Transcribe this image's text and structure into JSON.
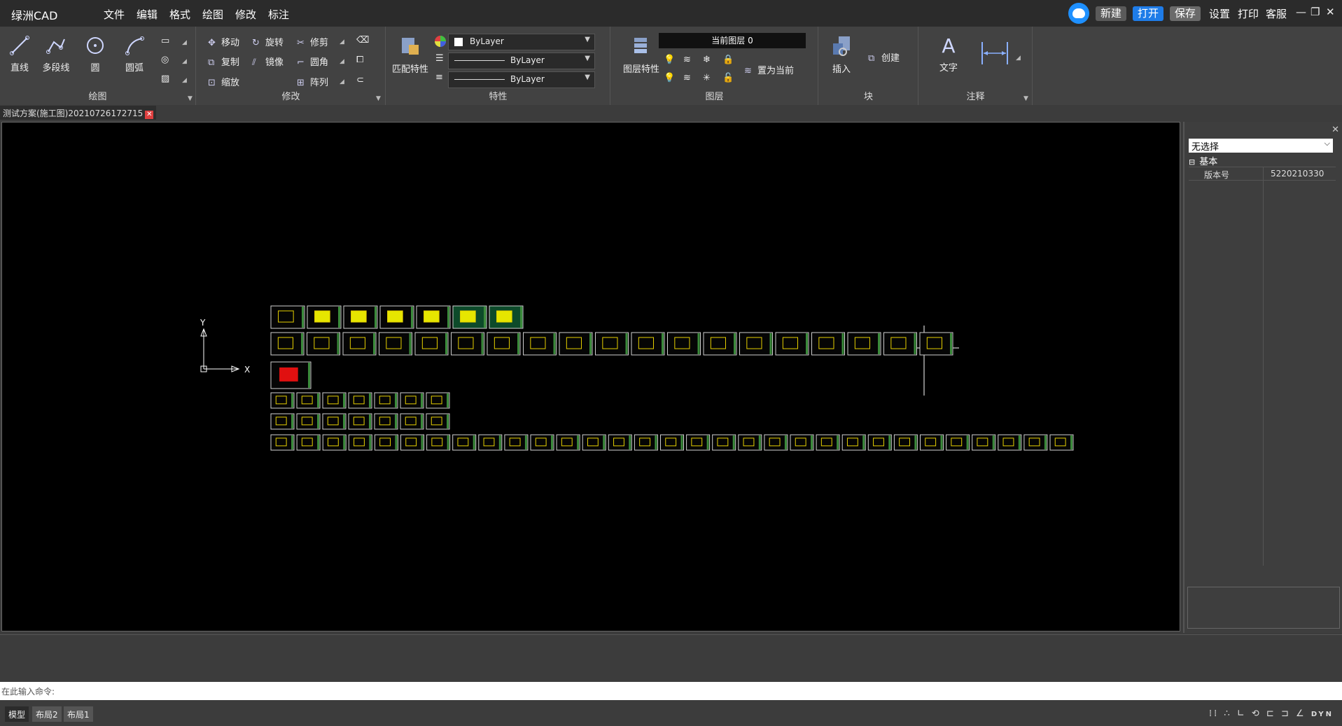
{
  "app": {
    "title": "绿洲CAD"
  },
  "menus": [
    "文件",
    "编辑",
    "格式",
    "绘图",
    "修改",
    "标注"
  ],
  "title_actions": {
    "new": "新建",
    "open": "打开",
    "save": "保存",
    "settings": "设置",
    "print": "打印",
    "service": "客服"
  },
  "colors": {
    "open_button": "#1e7ce8",
    "new_button": "#5a5a5a",
    "save_button": "#6a6a6a",
    "canvas": "#000000",
    "ribbon": "#424242"
  },
  "ribbon": {
    "draw": {
      "label": "绘图",
      "tools": [
        "直线",
        "多段线",
        "圆",
        "圆弧"
      ]
    },
    "modify": {
      "label": "修改",
      "tools": [
        "移动",
        "旋转",
        "修剪",
        "复制",
        "镜像",
        "圆角",
        "缩放",
        "阵列"
      ]
    },
    "properties": {
      "label": "特性",
      "match": "匹配特性",
      "color": "ByLayer",
      "linetype": "ByLayer",
      "lineweight": "ByLayer"
    },
    "layers": {
      "label": "图层",
      "layer_props": "图层特性",
      "current_layer": "当前图层 0",
      "set_current": "置为当前"
    },
    "block": {
      "label": "块",
      "insert": "插入",
      "create": "创建"
    },
    "annotation": {
      "label": "注释",
      "text": "文字"
    }
  },
  "document_tab": "测试方案(施工图)20210726172715",
  "canvas": {
    "axis_x": "X",
    "axis_y": "Y"
  },
  "panel": {
    "selection": "无选择",
    "section": "基本",
    "field_label": "版本号",
    "field_value": "5220210330"
  },
  "command": {
    "placeholder": "在此输入命令:"
  },
  "layout_tabs": [
    "模型",
    "布局2",
    "布局1"
  ],
  "status": {
    "dyn": "DYN"
  }
}
